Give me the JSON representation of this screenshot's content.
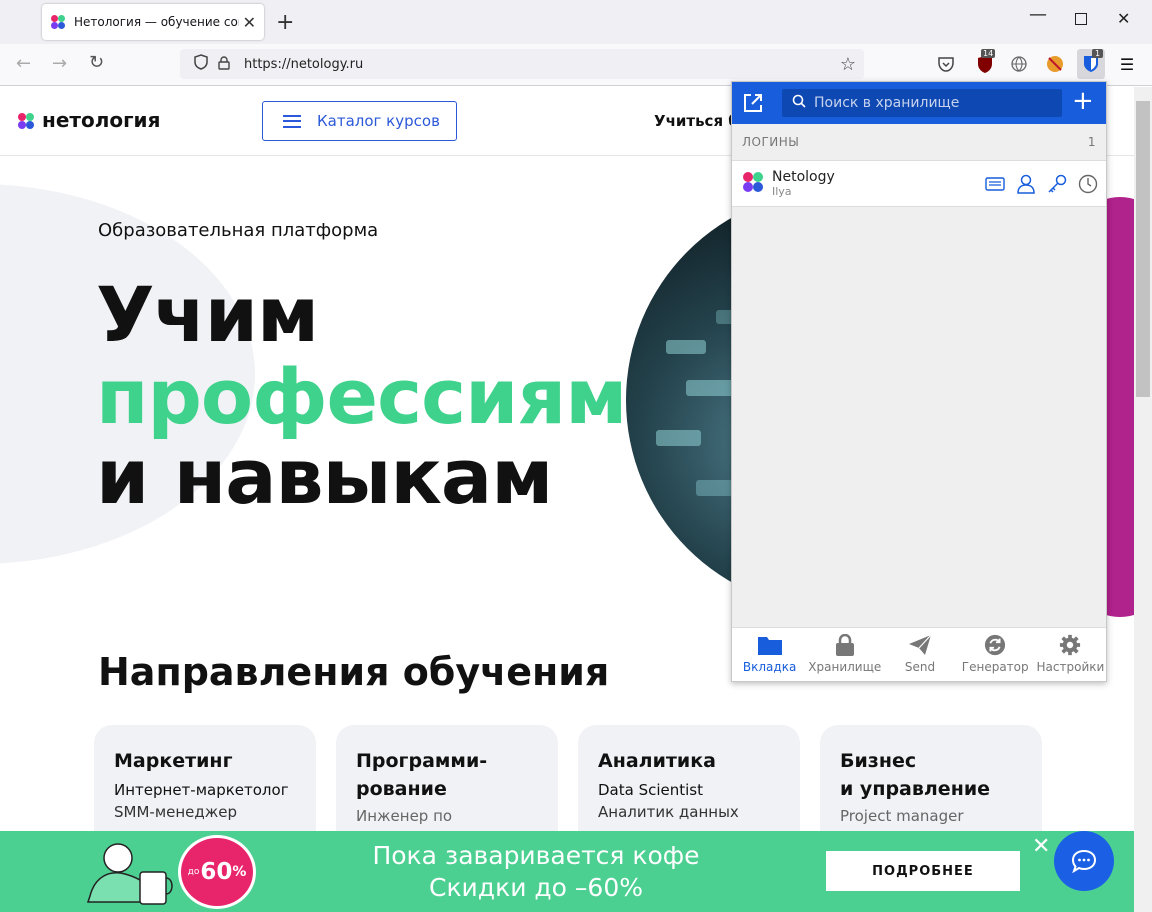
{
  "browser": {
    "tab_title": "Нетология — обучение совре",
    "url": "https://netology.ru",
    "ext_badge_ublock": "14",
    "ext_badge_bitwarden": "1"
  },
  "site": {
    "logo_text": "нетология",
    "catalog_label": "Каталог курсов",
    "nav_learn": "Учиться б",
    "platform_label": "Образовательная платформа",
    "hero_line1": "Учим",
    "hero_line2": "профессиям",
    "hero_line3": "и навыкам",
    "directions_title": "Направления обучения",
    "cards": [
      {
        "title": "Маркетинг",
        "sub1": "Интернет-маркетолог",
        "sub2": "SMM-менеджер"
      },
      {
        "title": "Программи-\nрование",
        "sub1": "Инженер по",
        "sub2": ""
      },
      {
        "title": "Аналитика",
        "sub1": "Data Scientist",
        "sub2": "Аналитик данных"
      },
      {
        "title": "Бизнес\nи управление",
        "sub1": "Project manager",
        "sub2": ""
      }
    ],
    "colors": {
      "accent_green": "#3fd28c",
      "brand_blue": "#2b59d9",
      "promo_pink": "#e8256b"
    }
  },
  "banner": {
    "line1": "Пока заваривается кофе",
    "line2": "Скидки до –60%",
    "discount_prefix": "до",
    "discount_value": "60",
    "discount_unit": "%",
    "button_label": "ПОДРОБНЕЕ"
  },
  "bitwarden": {
    "search_placeholder": "Поиск в хранилище",
    "section_title": "ЛОГИНЫ",
    "section_count": "1",
    "item_name": "Netology",
    "item_user": "Ilya",
    "tabs": [
      "Вкладка",
      "Хранилище",
      "Send",
      "Генератор",
      "Настройки"
    ],
    "colors": {
      "header_blue": "#175ddc"
    }
  }
}
